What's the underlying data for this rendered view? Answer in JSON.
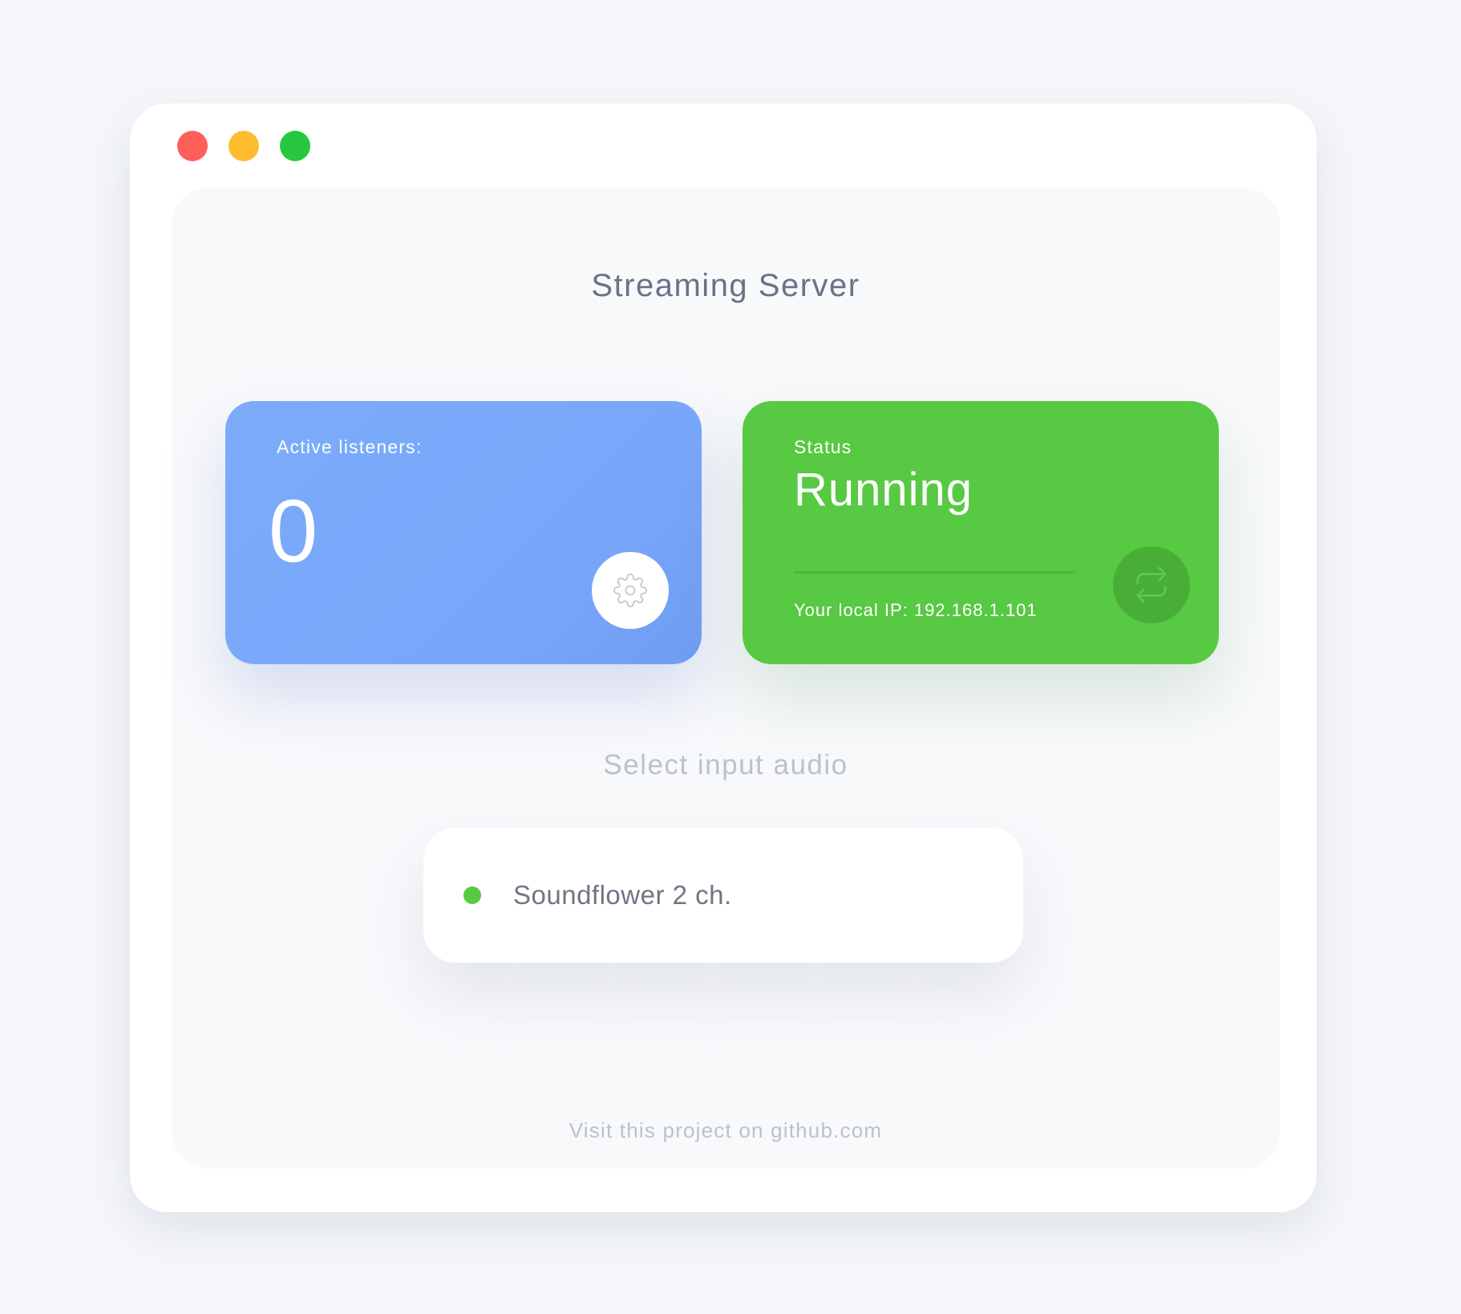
{
  "window": {
    "controls": {
      "close_color": "#fe5f58",
      "minimize_color": "#febc2e",
      "maximize_color": "#27c840"
    }
  },
  "page_title": "Streaming Server",
  "listeners_card": {
    "label": "Active listeners:",
    "value": "0",
    "color": "#78a7f9",
    "button_icon": "gear-icon"
  },
  "status_card": {
    "label": "Status",
    "value": "Running",
    "ip_text": "Your local IP: 192.168.1.101",
    "color": "#57c942",
    "button_icon": "refresh-icon"
  },
  "input_audio": {
    "section_title": "Select input audio",
    "devices": [
      {
        "name": "Soundflower 2 ch.",
        "status_color": "#57c942"
      }
    ]
  },
  "footer": {
    "link_text": "Visit this project on github.com"
  }
}
